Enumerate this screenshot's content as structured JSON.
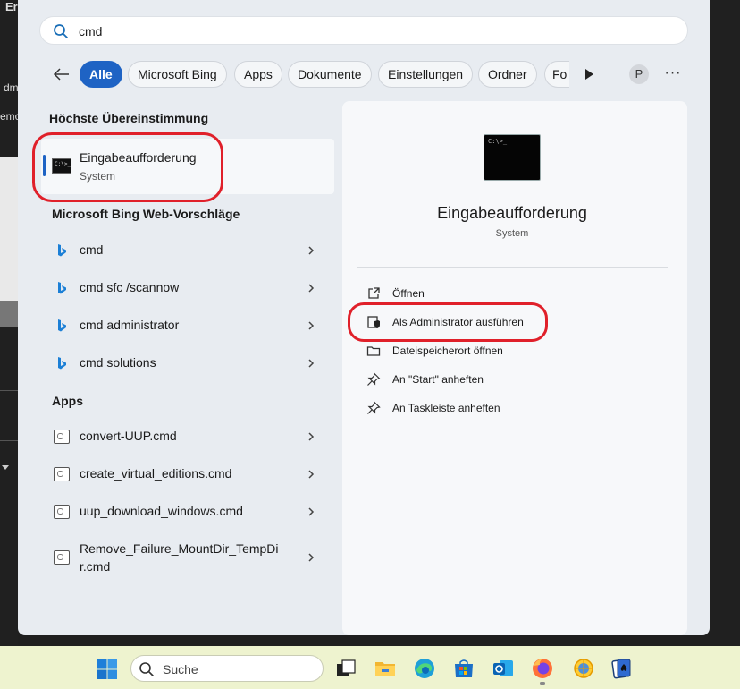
{
  "background": {
    "fragment_top": "Er",
    "fragment_admin": "dmi",
    "fragment_remove": "emo"
  },
  "search": {
    "value": "cmd"
  },
  "filters": {
    "back_label": "←",
    "chips": [
      "Alle",
      "Microsoft Bing",
      "Apps",
      "Dokumente",
      "Einstellungen",
      "Ordner",
      "Fo"
    ],
    "active": "Alle",
    "profile_initial": "P",
    "overflow_label": "···"
  },
  "best_match": {
    "heading": "Höchste Übereinstimmung",
    "title": "Eingabeaufforderung",
    "subtitle": "System",
    "icon": "terminal-icon",
    "icon_text": "C:\\>_"
  },
  "web": {
    "heading": "Microsoft Bing Web-Vorschläge",
    "items": [
      "cmd",
      "cmd sfc /scannow",
      "cmd administrator",
      "cmd solutions"
    ]
  },
  "apps": {
    "heading": "Apps",
    "items": [
      "convert-UUP.cmd",
      "create_virtual_editions.cmd",
      "uup_download_windows.cmd"
    ],
    "last_item_line1": "Remove_Failure_MountDir_TempDi",
    "last_item_line2": "r.cmd"
  },
  "preview": {
    "title": "Eingabeaufforderung",
    "subtitle": "System",
    "icon_text": "C:\\>_",
    "actions": [
      "Öffnen",
      "Als Administrator ausführen",
      "Dateispeicherort öffnen",
      "An \"Start\" anheften",
      "An Taskleiste anheften"
    ]
  },
  "taskbar": {
    "search_label": "Suche",
    "apps": [
      "task-view",
      "file-explorer",
      "edge",
      "microsoft-store",
      "outlook",
      "firefox",
      "app-sun",
      "solitaire"
    ]
  },
  "colors": {
    "accent": "#1e63c4",
    "annotation": "#e0202a",
    "panel": "#e8ecf1",
    "taskbar": "#eef3cf"
  }
}
